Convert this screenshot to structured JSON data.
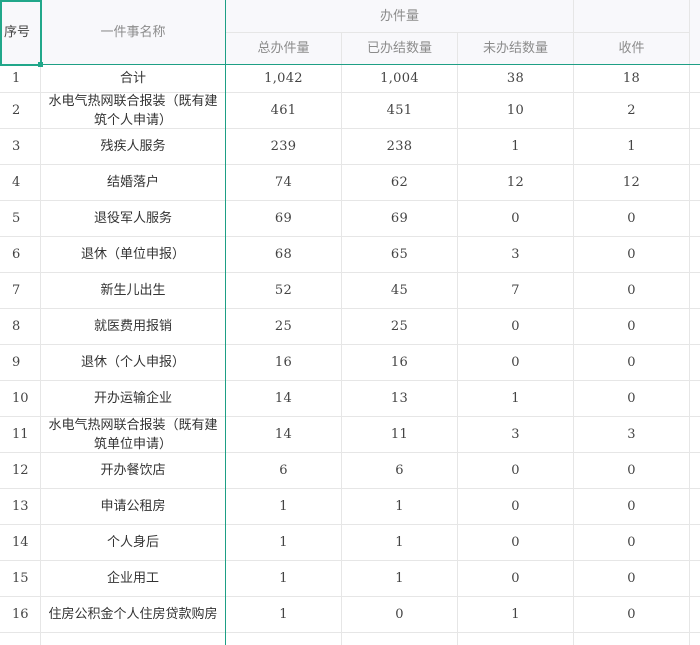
{
  "header": {
    "seq": "序号",
    "name": "一件事名称",
    "group_workload": "办件量",
    "group_blank": "",
    "col_total": "总办件量",
    "col_done": "已办结数量",
    "col_pending": "未办结数量",
    "col_received": "收件"
  },
  "rows": [
    {
      "seq": "1",
      "name": "合计",
      "total": "1,042",
      "done": "1,004",
      "pending": "38",
      "received": "18"
    },
    {
      "seq": "2",
      "name": "水电气热网联合报装（既有建筑个人申请）",
      "total": "461",
      "done": "451",
      "pending": "10",
      "received": "2"
    },
    {
      "seq": "3",
      "name": "残疾人服务",
      "total": "239",
      "done": "238",
      "pending": "1",
      "received": "1"
    },
    {
      "seq": "4",
      "name": "结婚落户",
      "total": "74",
      "done": "62",
      "pending": "12",
      "received": "12"
    },
    {
      "seq": "5",
      "name": "退役军人服务",
      "total": "69",
      "done": "69",
      "pending": "0",
      "received": "0"
    },
    {
      "seq": "6",
      "name": "退休（单位申报）",
      "total": "68",
      "done": "65",
      "pending": "3",
      "received": "0"
    },
    {
      "seq": "7",
      "name": "新生儿出生",
      "total": "52",
      "done": "45",
      "pending": "7",
      "received": "0"
    },
    {
      "seq": "8",
      "name": "就医费用报销",
      "total": "25",
      "done": "25",
      "pending": "0",
      "received": "0"
    },
    {
      "seq": "9",
      "name": "退休（个人申报）",
      "total": "16",
      "done": "16",
      "pending": "0",
      "received": "0"
    },
    {
      "seq": "10",
      "name": "开办运输企业",
      "total": "14",
      "done": "13",
      "pending": "1",
      "received": "0"
    },
    {
      "seq": "11",
      "name": "水电气热网联合报装（既有建筑单位申请）",
      "total": "14",
      "done": "11",
      "pending": "3",
      "received": "3"
    },
    {
      "seq": "12",
      "name": "开办餐饮店",
      "total": "6",
      "done": "6",
      "pending": "0",
      "received": "0"
    },
    {
      "seq": "13",
      "name": "申请公租房",
      "total": "1",
      "done": "1",
      "pending": "0",
      "received": "0"
    },
    {
      "seq": "14",
      "name": "个人身后",
      "total": "1",
      "done": "1",
      "pending": "0",
      "received": "0"
    },
    {
      "seq": "15",
      "name": "企业用工",
      "total": "1",
      "done": "1",
      "pending": "0",
      "received": "0"
    },
    {
      "seq": "16",
      "name": "住房公积金个人住房贷款购房",
      "total": "1",
      "done": "0",
      "pending": "1",
      "received": "0"
    }
  ],
  "colors": {
    "accent": "#21a78a",
    "header_bg": "#f8f8fb",
    "grid": "#e6e6e6"
  }
}
